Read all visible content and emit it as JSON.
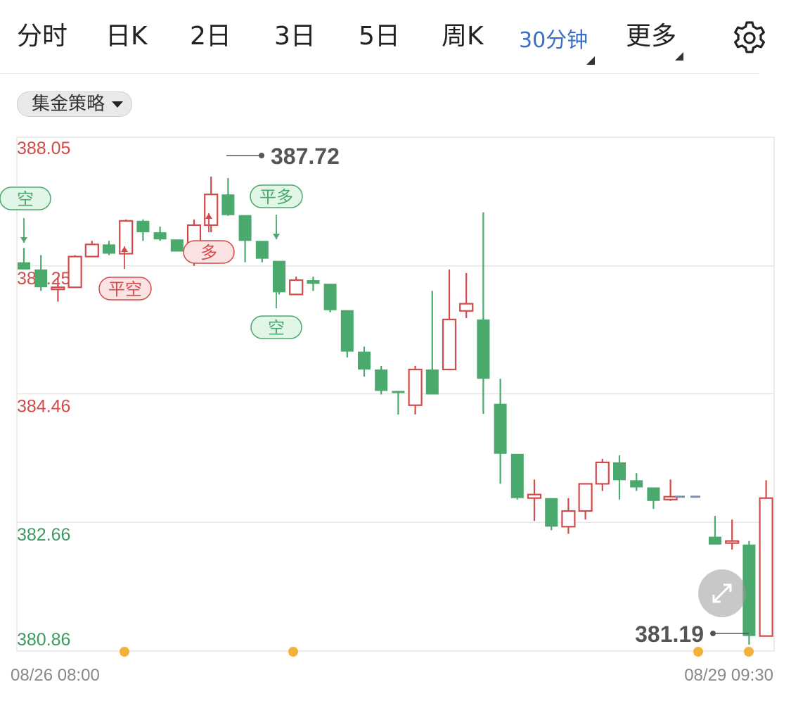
{
  "tabs": [
    {
      "label": "分时",
      "active": false
    },
    {
      "label": "日K",
      "active": false
    },
    {
      "label": "2日",
      "active": false
    },
    {
      "label": "3日",
      "active": false
    },
    {
      "label": "5日",
      "active": false
    },
    {
      "label": "周K",
      "active": false
    },
    {
      "label": "30分钟",
      "active": true
    },
    {
      "label": "更多",
      "active": false
    }
  ],
  "settings_icon": "gear-icon",
  "strategy": {
    "label": "集金策略",
    "icon": "caret-down-icon"
  },
  "expand_icon": "expand-arrows-icon",
  "colors": {
    "up": "#d24b4b",
    "down": "#4aa96c",
    "accent": "#3b6fc4",
    "marker": "#f2b13c"
  },
  "chart_data": {
    "type": "candlestick",
    "interval": "30分钟",
    "y_ticks": [
      "388.05",
      "386.25",
      "384.46",
      "382.66",
      "380.86"
    ],
    "ylim": [
      380.86,
      388.05
    ],
    "x_start_label": "08/26 08:00",
    "x_end_label": "08/29 09:30",
    "high_label": "387.72",
    "low_label": "381.19",
    "candles": [
      {
        "o": 386.3,
        "h": 386.5,
        "l": 386.2,
        "c": 386.2
      },
      {
        "o": 386.2,
        "h": 386.4,
        "l": 385.9,
        "c": 385.95
      },
      {
        "o": 385.95,
        "h": 386.1,
        "l": 385.75,
        "c": 385.95
      },
      {
        "o": 385.95,
        "h": 386.4,
        "l": 385.95,
        "c": 386.38
      },
      {
        "o": 386.38,
        "h": 386.6,
        "l": 386.38,
        "c": 386.55
      },
      {
        "o": 386.55,
        "h": 386.6,
        "l": 386.4,
        "c": 386.42
      },
      {
        "o": 386.42,
        "h": 386.9,
        "l": 386.42,
        "c": 386.88
      },
      {
        "o": 386.88,
        "h": 386.9,
        "l": 386.6,
        "c": 386.72
      },
      {
        "o": 386.72,
        "h": 386.8,
        "l": 386.6,
        "c": 386.62
      },
      {
        "o": 386.62,
        "h": 386.62,
        "l": 386.45,
        "c": 386.45
      },
      {
        "o": 386.45,
        "h": 386.9,
        "l": 386.25,
        "c": 386.82
      },
      {
        "o": 386.82,
        "h": 387.5,
        "l": 386.72,
        "c": 387.25
      },
      {
        "o": 387.25,
        "h": 387.48,
        "l": 386.95,
        "c": 386.96
      },
      {
        "o": 386.96,
        "h": 386.96,
        "l": 386.3,
        "c": 386.6
      },
      {
        "o": 386.6,
        "h": 386.6,
        "l": 386.3,
        "c": 386.35
      },
      {
        "o": 386.32,
        "h": 386.32,
        "l": 385.85,
        "c": 385.88
      },
      {
        "o": 385.85,
        "h": 386.1,
        "l": 385.85,
        "c": 386.05
      },
      {
        "o": 386.05,
        "h": 386.1,
        "l": 385.9,
        "c": 386.0
      },
      {
        "o": 386.0,
        "h": 386.0,
        "l": 385.6,
        "c": 385.63
      },
      {
        "o": 385.63,
        "h": 385.63,
        "l": 384.97,
        "c": 385.05
      },
      {
        "o": 385.05,
        "h": 385.12,
        "l": 384.7,
        "c": 384.8
      },
      {
        "o": 384.8,
        "h": 384.85,
        "l": 384.45,
        "c": 384.5
      },
      {
        "o": 384.5,
        "h": 384.5,
        "l": 384.17,
        "c": 384.48
      },
      {
        "o": 384.3,
        "h": 384.85,
        "l": 384.17,
        "c": 384.8
      },
      {
        "o": 384.8,
        "h": 385.9,
        "l": 384.45,
        "c": 384.45
      },
      {
        "o": 384.8,
        "h": 386.2,
        "l": 384.8,
        "c": 385.5
      },
      {
        "o": 385.62,
        "h": 386.15,
        "l": 385.52,
        "c": 385.72
      },
      {
        "o": 385.5,
        "h": 387.0,
        "l": 384.18,
        "c": 384.67
      },
      {
        "o": 384.32,
        "h": 384.67,
        "l": 383.2,
        "c": 383.62
      },
      {
        "o": 383.62,
        "h": 383.62,
        "l": 382.98,
        "c": 383.0
      },
      {
        "o": 383.0,
        "h": 383.26,
        "l": 382.68,
        "c": 383.05
      },
      {
        "o": 383.0,
        "h": 383.0,
        "l": 382.55,
        "c": 382.6
      },
      {
        "o": 382.6,
        "h": 383.0,
        "l": 382.5,
        "c": 382.82
      },
      {
        "o": 382.82,
        "h": 383.2,
        "l": 382.7,
        "c": 383.2
      },
      {
        "o": 383.2,
        "h": 383.55,
        "l": 383.1,
        "c": 383.5
      },
      {
        "o": 383.5,
        "h": 383.6,
        "l": 382.98,
        "c": 383.25
      },
      {
        "o": 383.25,
        "h": 383.35,
        "l": 383.1,
        "c": 383.15
      },
      {
        "o": 383.15,
        "h": 383.15,
        "l": 382.85,
        "c": 382.96
      },
      {
        "o": 382.98,
        "h": 383.26,
        "l": 382.96,
        "c": 383.02
      }
    ],
    "gap_candles": [
      {
        "o": 382.46,
        "h": 382.75,
        "l": 382.4,
        "c": 382.35
      },
      {
        "o": 382.4,
        "h": 382.7,
        "l": 382.28,
        "c": 382.4
      },
      {
        "o": 382.35,
        "h": 382.4,
        "l": 380.95,
        "c": 381.07
      },
      {
        "o": 381.07,
        "h": 383.25,
        "l": 381.07,
        "c": 383.0
      }
    ],
    "signals": [
      {
        "label": "空",
        "type": "short"
      },
      {
        "label": "平空",
        "type": "close-short"
      },
      {
        "label": "多",
        "type": "long"
      },
      {
        "label": "平多",
        "type": "close-long"
      },
      {
        "label": "空",
        "type": "short"
      }
    ]
  }
}
